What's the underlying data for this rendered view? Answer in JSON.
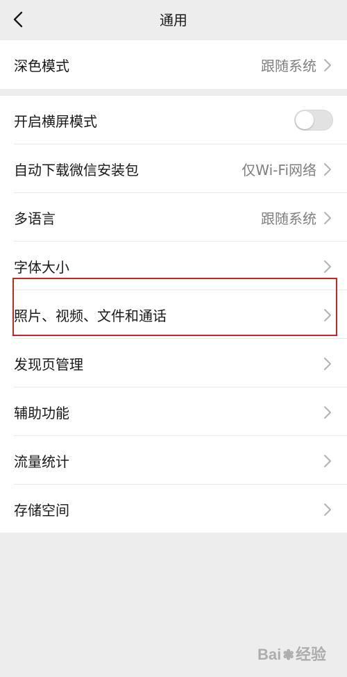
{
  "nav": {
    "title": "通用"
  },
  "group1": {
    "dark_mode": {
      "label": "深色模式",
      "value": "跟随系统"
    }
  },
  "group2": {
    "landscape": {
      "label": "开启横屏模式",
      "toggle_on": false
    },
    "auto_download": {
      "label": "自动下载微信安装包",
      "value": "仅Wi-Fi网络"
    },
    "language": {
      "label": "多语言",
      "value": "跟随系统"
    },
    "font_size": {
      "label": "字体大小"
    },
    "media": {
      "label": "照片、视频、文件和通话"
    },
    "discover": {
      "label": "发现页管理"
    },
    "accessibility": {
      "label": "辅助功能"
    },
    "data_usage": {
      "label": "流量统计"
    },
    "storage": {
      "label": "存储空间"
    }
  },
  "watermark": {
    "brand": "Bai",
    "suffix": "经验"
  },
  "colors": {
    "highlight": "#c0282d",
    "background": "#ededed",
    "card": "#ffffff"
  }
}
